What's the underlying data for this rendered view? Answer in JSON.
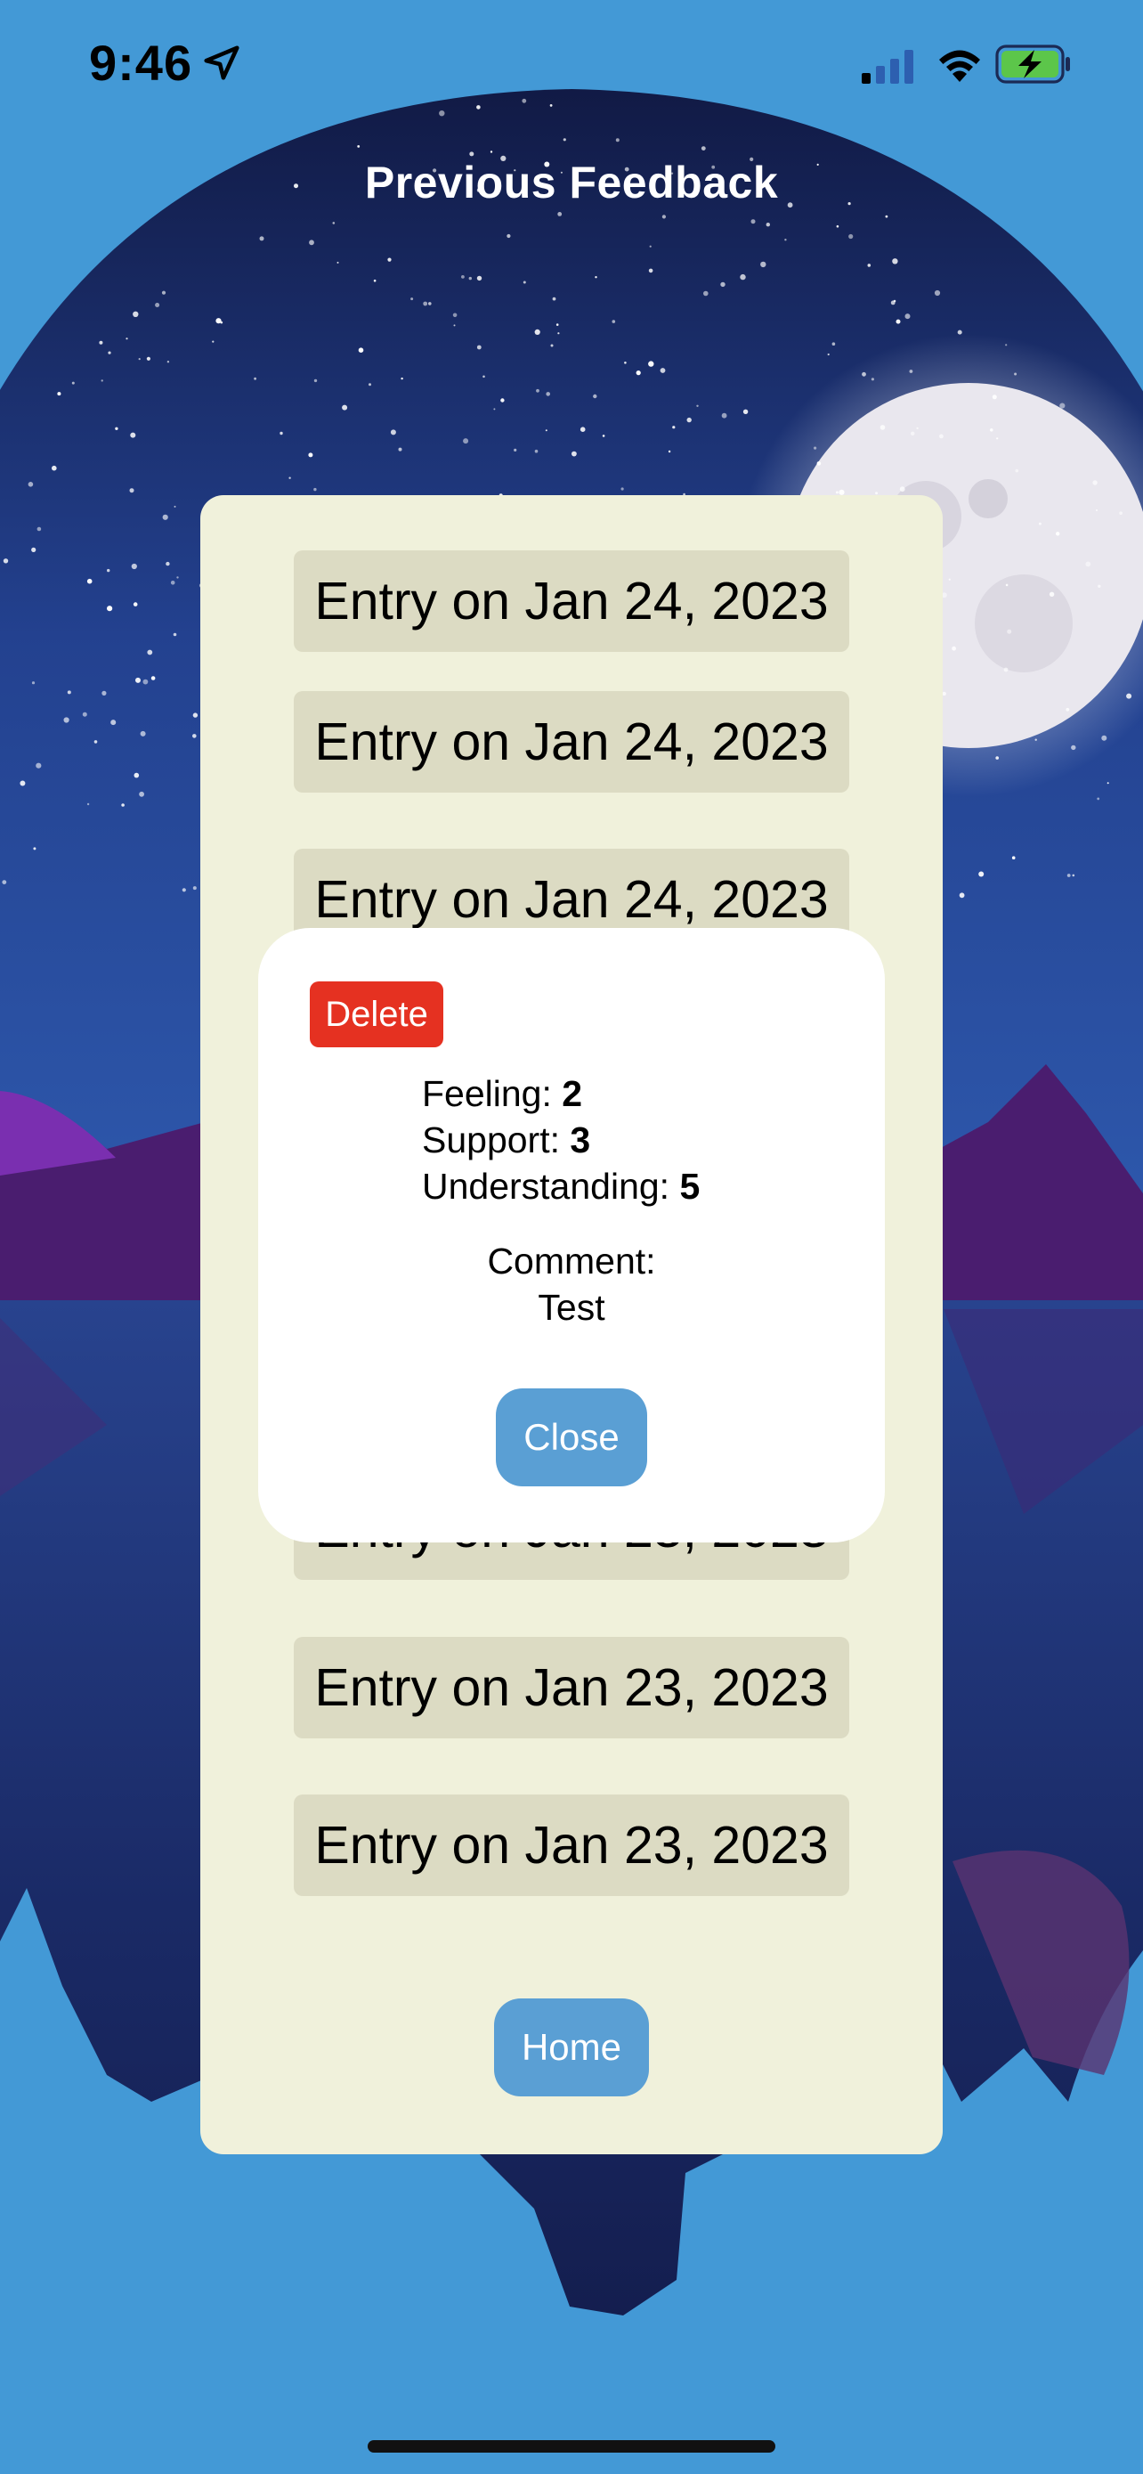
{
  "status_bar": {
    "time": "9:46",
    "icons": [
      "location-arrow-icon",
      "cellular-signal-icon",
      "wifi-icon",
      "battery-charging-icon"
    ]
  },
  "header": {
    "title": "Previous Feedback"
  },
  "entries": [
    {
      "label": "Entry on Jan 24, 2023"
    },
    {
      "label": "Entry on Jan 24, 2023"
    },
    {
      "label": "Entry on Jan 24, 2023"
    },
    {
      "label": "Entry on Jan 23, 2023"
    },
    {
      "label": "Entry on Jan 23, 2023"
    },
    {
      "label": "Entry on Jan 23, 2023"
    }
  ],
  "home_button": {
    "label": "Home"
  },
  "modal": {
    "delete_label": "Delete",
    "feeling_label": "Feeling:",
    "feeling_value": "2",
    "support_label": "Support:",
    "support_value": "3",
    "understanding_label": "Understanding:",
    "understanding_value": "5",
    "comment_label": "Comment:",
    "comment_value": "Test",
    "close_label": "Close"
  },
  "colors": {
    "background": "#4399d6",
    "panel": "#f0f1db",
    "entry": "#dcdbc3",
    "button": "#5a9fd4",
    "delete": "#e53121"
  }
}
